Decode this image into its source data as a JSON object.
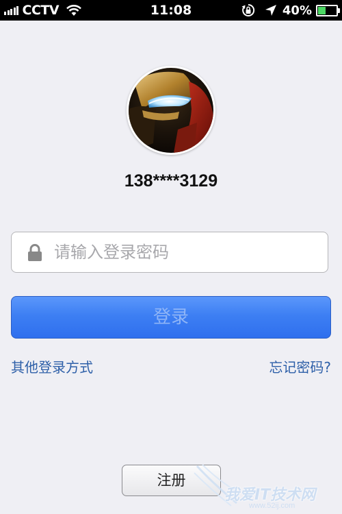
{
  "status_bar": {
    "carrier": "CCTV",
    "time": "11:08",
    "battery_percent": "40%",
    "battery_level": 0.4,
    "icons": [
      "signal-bars-icon",
      "wifi-icon",
      "rotation-lock-icon",
      "location-arrow-icon",
      "battery-icon"
    ]
  },
  "profile": {
    "avatar_icon": "iron-man-avatar",
    "username": "138****3129"
  },
  "password": {
    "placeholder": "请输入登录密码",
    "value": "",
    "icon": "lock-icon"
  },
  "actions": {
    "login_label": "登录",
    "other_login_label": "其他登录方式",
    "forgot_password_label": "忘记密码?",
    "register_label": "注册"
  },
  "watermark": {
    "text": "我爱IT技术网",
    "url": "www.52ij.com"
  },
  "colors": {
    "background": "#efeff4",
    "primary_button": "#3d7ff3",
    "link": "#2d5fa8"
  }
}
